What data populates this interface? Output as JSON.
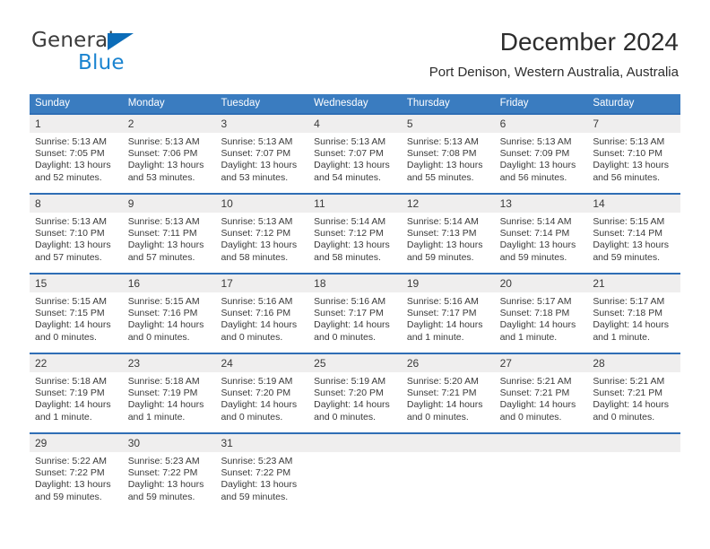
{
  "logo": {
    "text_primary": "General",
    "text_secondary": "Blue",
    "icon": "triangle-logo-mark",
    "color_primary": "#3c3c3c",
    "color_secondary": "#1b84d0"
  },
  "header": {
    "title": "December 2024",
    "subtitle": "Port Denison, Western Australia, Australia"
  },
  "theme": {
    "header_bar": "#3a7cc0",
    "row_border": "#2f6eb5",
    "day_strip": "#efeeee",
    "text": "#3a3a3a"
  },
  "weekdays": [
    "Sunday",
    "Monday",
    "Tuesday",
    "Wednesday",
    "Thursday",
    "Friday",
    "Saturday"
  ],
  "weeks": [
    [
      {
        "day": "1",
        "sunrise": "Sunrise: 5:13 AM",
        "sunset": "Sunset: 7:05 PM",
        "daylight1": "Daylight: 13 hours",
        "daylight2": "and 52 minutes."
      },
      {
        "day": "2",
        "sunrise": "Sunrise: 5:13 AM",
        "sunset": "Sunset: 7:06 PM",
        "daylight1": "Daylight: 13 hours",
        "daylight2": "and 53 minutes."
      },
      {
        "day": "3",
        "sunrise": "Sunrise: 5:13 AM",
        "sunset": "Sunset: 7:07 PM",
        "daylight1": "Daylight: 13 hours",
        "daylight2": "and 53 minutes."
      },
      {
        "day": "4",
        "sunrise": "Sunrise: 5:13 AM",
        "sunset": "Sunset: 7:07 PM",
        "daylight1": "Daylight: 13 hours",
        "daylight2": "and 54 minutes."
      },
      {
        "day": "5",
        "sunrise": "Sunrise: 5:13 AM",
        "sunset": "Sunset: 7:08 PM",
        "daylight1": "Daylight: 13 hours",
        "daylight2": "and 55 minutes."
      },
      {
        "day": "6",
        "sunrise": "Sunrise: 5:13 AM",
        "sunset": "Sunset: 7:09 PM",
        "daylight1": "Daylight: 13 hours",
        "daylight2": "and 56 minutes."
      },
      {
        "day": "7",
        "sunrise": "Sunrise: 5:13 AM",
        "sunset": "Sunset: 7:10 PM",
        "daylight1": "Daylight: 13 hours",
        "daylight2": "and 56 minutes."
      }
    ],
    [
      {
        "day": "8",
        "sunrise": "Sunrise: 5:13 AM",
        "sunset": "Sunset: 7:10 PM",
        "daylight1": "Daylight: 13 hours",
        "daylight2": "and 57 minutes."
      },
      {
        "day": "9",
        "sunrise": "Sunrise: 5:13 AM",
        "sunset": "Sunset: 7:11 PM",
        "daylight1": "Daylight: 13 hours",
        "daylight2": "and 57 minutes."
      },
      {
        "day": "10",
        "sunrise": "Sunrise: 5:13 AM",
        "sunset": "Sunset: 7:12 PM",
        "daylight1": "Daylight: 13 hours",
        "daylight2": "and 58 minutes."
      },
      {
        "day": "11",
        "sunrise": "Sunrise: 5:14 AM",
        "sunset": "Sunset: 7:12 PM",
        "daylight1": "Daylight: 13 hours",
        "daylight2": "and 58 minutes."
      },
      {
        "day": "12",
        "sunrise": "Sunrise: 5:14 AM",
        "sunset": "Sunset: 7:13 PM",
        "daylight1": "Daylight: 13 hours",
        "daylight2": "and 59 minutes."
      },
      {
        "day": "13",
        "sunrise": "Sunrise: 5:14 AM",
        "sunset": "Sunset: 7:14 PM",
        "daylight1": "Daylight: 13 hours",
        "daylight2": "and 59 minutes."
      },
      {
        "day": "14",
        "sunrise": "Sunrise: 5:15 AM",
        "sunset": "Sunset: 7:14 PM",
        "daylight1": "Daylight: 13 hours",
        "daylight2": "and 59 minutes."
      }
    ],
    [
      {
        "day": "15",
        "sunrise": "Sunrise: 5:15 AM",
        "sunset": "Sunset: 7:15 PM",
        "daylight1": "Daylight: 14 hours",
        "daylight2": "and 0 minutes."
      },
      {
        "day": "16",
        "sunrise": "Sunrise: 5:15 AM",
        "sunset": "Sunset: 7:16 PM",
        "daylight1": "Daylight: 14 hours",
        "daylight2": "and 0 minutes."
      },
      {
        "day": "17",
        "sunrise": "Sunrise: 5:16 AM",
        "sunset": "Sunset: 7:16 PM",
        "daylight1": "Daylight: 14 hours",
        "daylight2": "and 0 minutes."
      },
      {
        "day": "18",
        "sunrise": "Sunrise: 5:16 AM",
        "sunset": "Sunset: 7:17 PM",
        "daylight1": "Daylight: 14 hours",
        "daylight2": "and 0 minutes."
      },
      {
        "day": "19",
        "sunrise": "Sunrise: 5:16 AM",
        "sunset": "Sunset: 7:17 PM",
        "daylight1": "Daylight: 14 hours",
        "daylight2": "and 1 minute."
      },
      {
        "day": "20",
        "sunrise": "Sunrise: 5:17 AM",
        "sunset": "Sunset: 7:18 PM",
        "daylight1": "Daylight: 14 hours",
        "daylight2": "and 1 minute."
      },
      {
        "day": "21",
        "sunrise": "Sunrise: 5:17 AM",
        "sunset": "Sunset: 7:18 PM",
        "daylight1": "Daylight: 14 hours",
        "daylight2": "and 1 minute."
      }
    ],
    [
      {
        "day": "22",
        "sunrise": "Sunrise: 5:18 AM",
        "sunset": "Sunset: 7:19 PM",
        "daylight1": "Daylight: 14 hours",
        "daylight2": "and 1 minute."
      },
      {
        "day": "23",
        "sunrise": "Sunrise: 5:18 AM",
        "sunset": "Sunset: 7:19 PM",
        "daylight1": "Daylight: 14 hours",
        "daylight2": "and 1 minute."
      },
      {
        "day": "24",
        "sunrise": "Sunrise: 5:19 AM",
        "sunset": "Sunset: 7:20 PM",
        "daylight1": "Daylight: 14 hours",
        "daylight2": "and 0 minutes."
      },
      {
        "day": "25",
        "sunrise": "Sunrise: 5:19 AM",
        "sunset": "Sunset: 7:20 PM",
        "daylight1": "Daylight: 14 hours",
        "daylight2": "and 0 minutes."
      },
      {
        "day": "26",
        "sunrise": "Sunrise: 5:20 AM",
        "sunset": "Sunset: 7:21 PM",
        "daylight1": "Daylight: 14 hours",
        "daylight2": "and 0 minutes."
      },
      {
        "day": "27",
        "sunrise": "Sunrise: 5:21 AM",
        "sunset": "Sunset: 7:21 PM",
        "daylight1": "Daylight: 14 hours",
        "daylight2": "and 0 minutes."
      },
      {
        "day": "28",
        "sunrise": "Sunrise: 5:21 AM",
        "sunset": "Sunset: 7:21 PM",
        "daylight1": "Daylight: 14 hours",
        "daylight2": "and 0 minutes."
      }
    ],
    [
      {
        "day": "29",
        "sunrise": "Sunrise: 5:22 AM",
        "sunset": "Sunset: 7:22 PM",
        "daylight1": "Daylight: 13 hours",
        "daylight2": "and 59 minutes."
      },
      {
        "day": "30",
        "sunrise": "Sunrise: 5:23 AM",
        "sunset": "Sunset: 7:22 PM",
        "daylight1": "Daylight: 13 hours",
        "daylight2": "and 59 minutes."
      },
      {
        "day": "31",
        "sunrise": "Sunrise: 5:23 AM",
        "sunset": "Sunset: 7:22 PM",
        "daylight1": "Daylight: 13 hours",
        "daylight2": "and 59 minutes."
      },
      {
        "day": "",
        "sunrise": "",
        "sunset": "",
        "daylight1": "",
        "daylight2": ""
      },
      {
        "day": "",
        "sunrise": "",
        "sunset": "",
        "daylight1": "",
        "daylight2": ""
      },
      {
        "day": "",
        "sunrise": "",
        "sunset": "",
        "daylight1": "",
        "daylight2": ""
      },
      {
        "day": "",
        "sunrise": "",
        "sunset": "",
        "daylight1": "",
        "daylight2": ""
      }
    ]
  ]
}
